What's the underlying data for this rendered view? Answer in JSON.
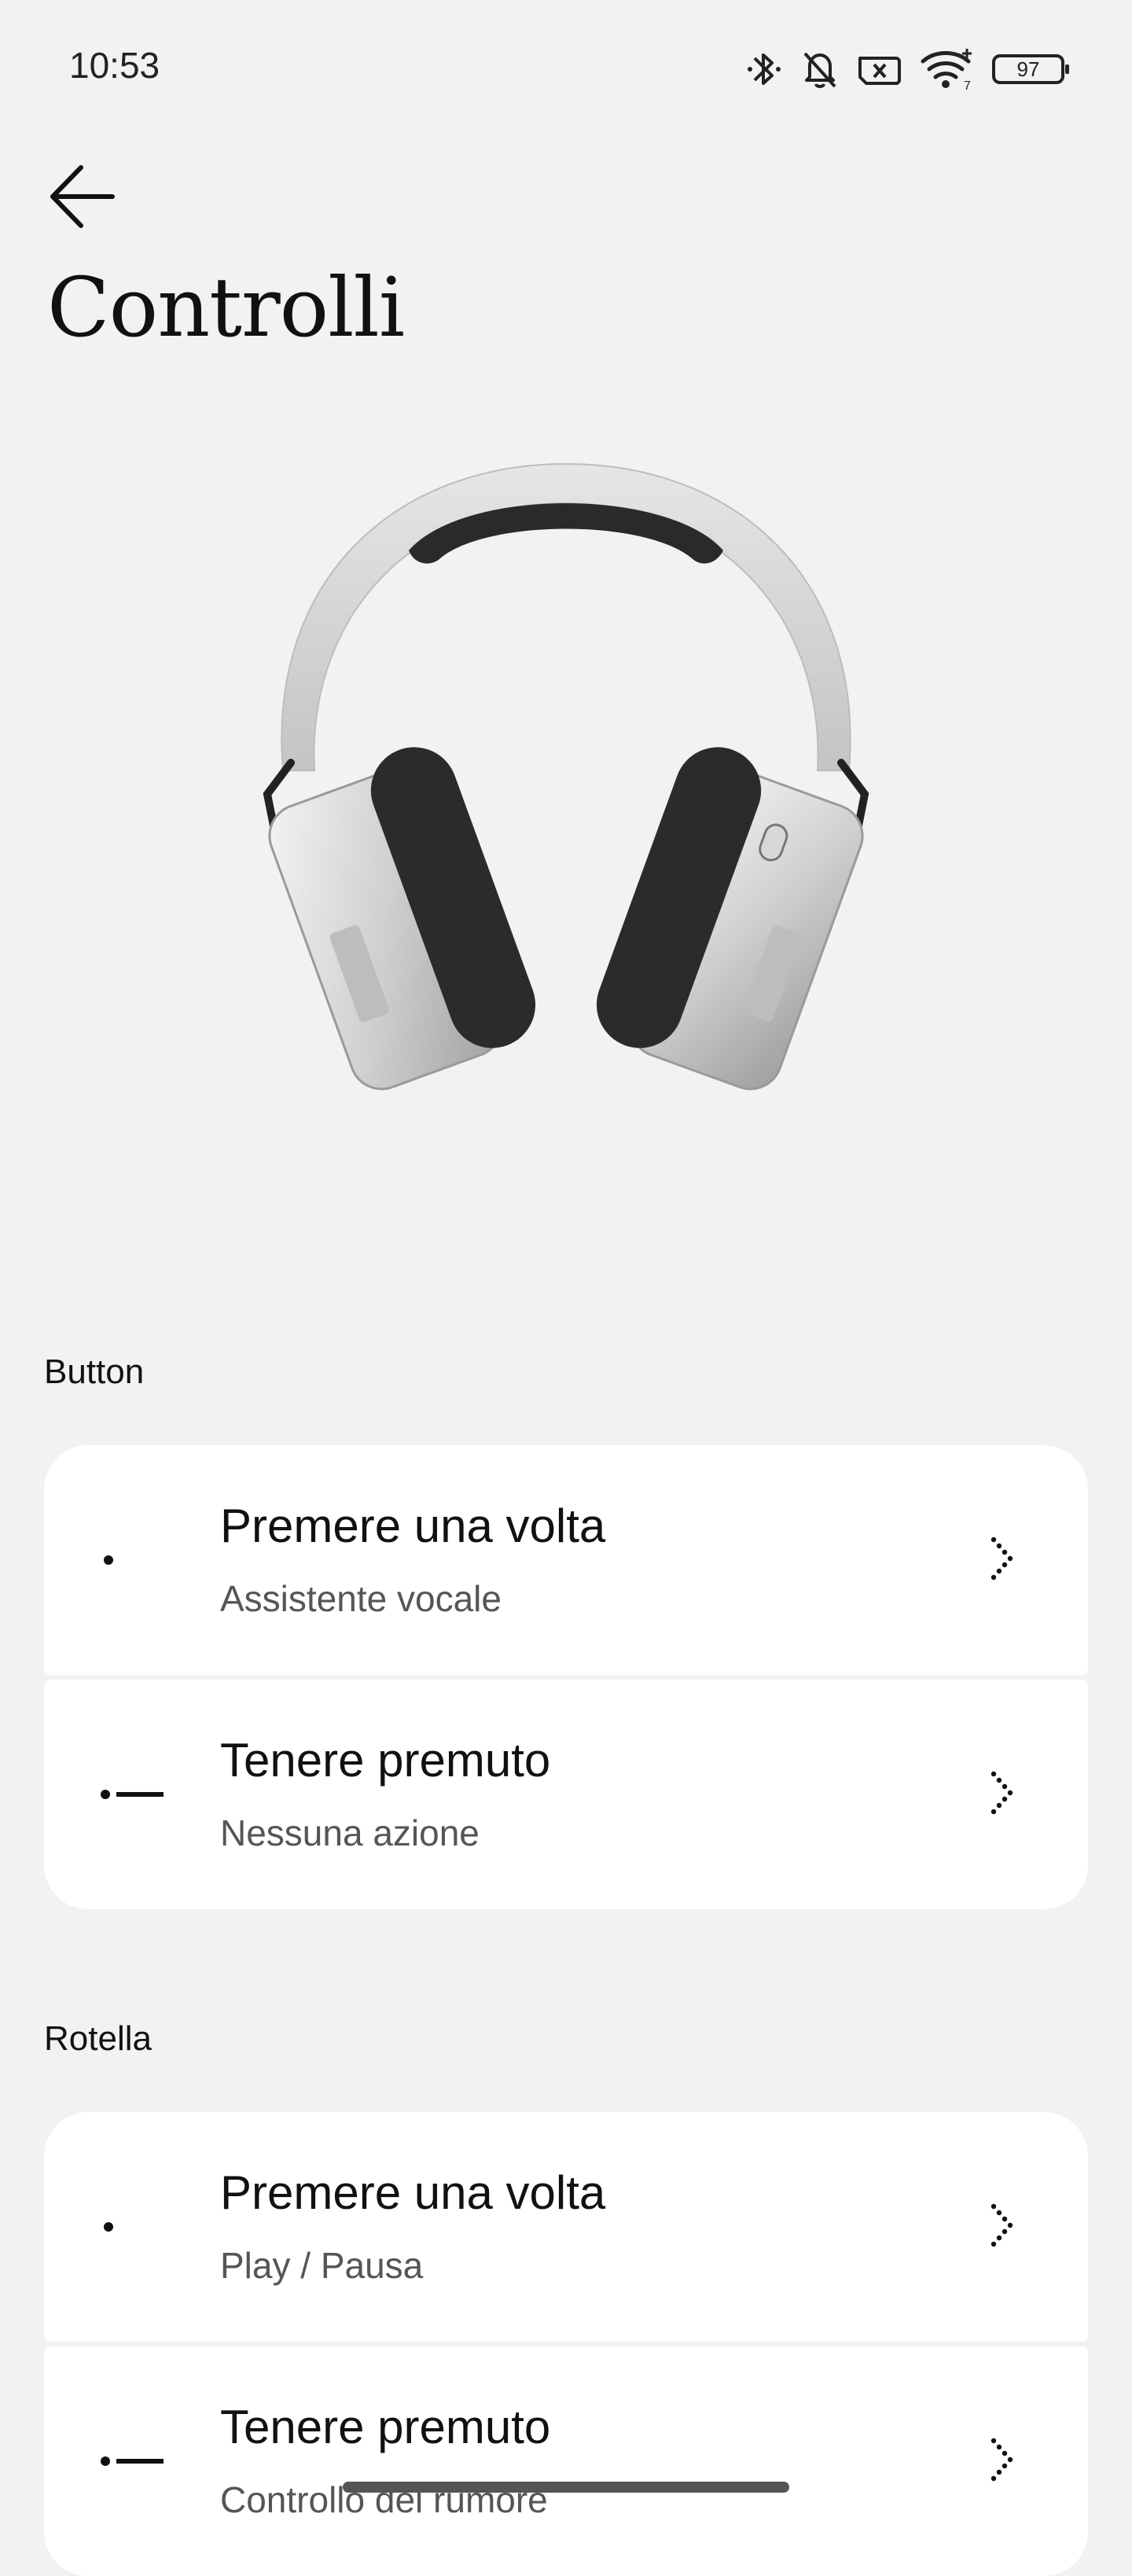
{
  "status_bar": {
    "time": "10:53",
    "battery": "97",
    "icons": [
      "bluetooth-icon",
      "bell-off-icon",
      "no-sim-icon",
      "wifi-icon",
      "battery-icon"
    ]
  },
  "header": {
    "back_icon": "arrow-left-icon",
    "title": "Controlli"
  },
  "sections": [
    {
      "label": "Button",
      "rows": [
        {
          "title": "Premere una volta",
          "subtitle": "Assistente vocale",
          "icon": "single-press-icon"
        },
        {
          "title": "Tenere premuto",
          "subtitle": "Nessuna azione",
          "icon": "long-press-icon"
        }
      ]
    },
    {
      "label": "Rotella",
      "rows": [
        {
          "title": "Premere una volta",
          "subtitle": "Play / Pausa",
          "icon": "single-press-icon"
        },
        {
          "title": "Tenere premuto",
          "subtitle": "Controllo del rumore",
          "icon": "long-press-icon"
        }
      ]
    }
  ],
  "colors": {
    "background": "#f2f2f2",
    "card": "#ffffff",
    "text_primary": "#111111",
    "text_secondary": "#555555"
  }
}
